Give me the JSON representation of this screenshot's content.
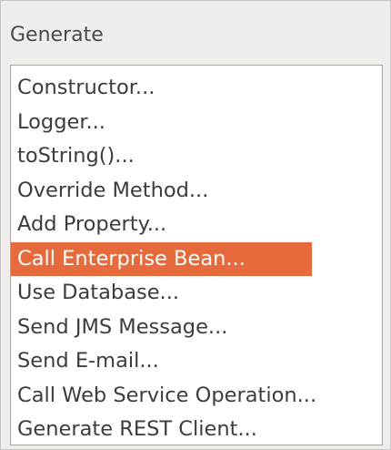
{
  "popup": {
    "title": "Generate",
    "selected_color": "#e66a3b",
    "items": [
      {
        "label": "Constructor..."
      },
      {
        "label": "Logger..."
      },
      {
        "label": "toString()..."
      },
      {
        "label": "Override Method..."
      },
      {
        "label": "Add Property..."
      },
      {
        "label": "Call Enterprise Bean...",
        "selected": true
      },
      {
        "label": "Use Database..."
      },
      {
        "label": "Send JMS Message..."
      },
      {
        "label": "Send E-mail..."
      },
      {
        "label": "Call Web Service Operation..."
      },
      {
        "label": "Generate REST Client..."
      }
    ]
  }
}
